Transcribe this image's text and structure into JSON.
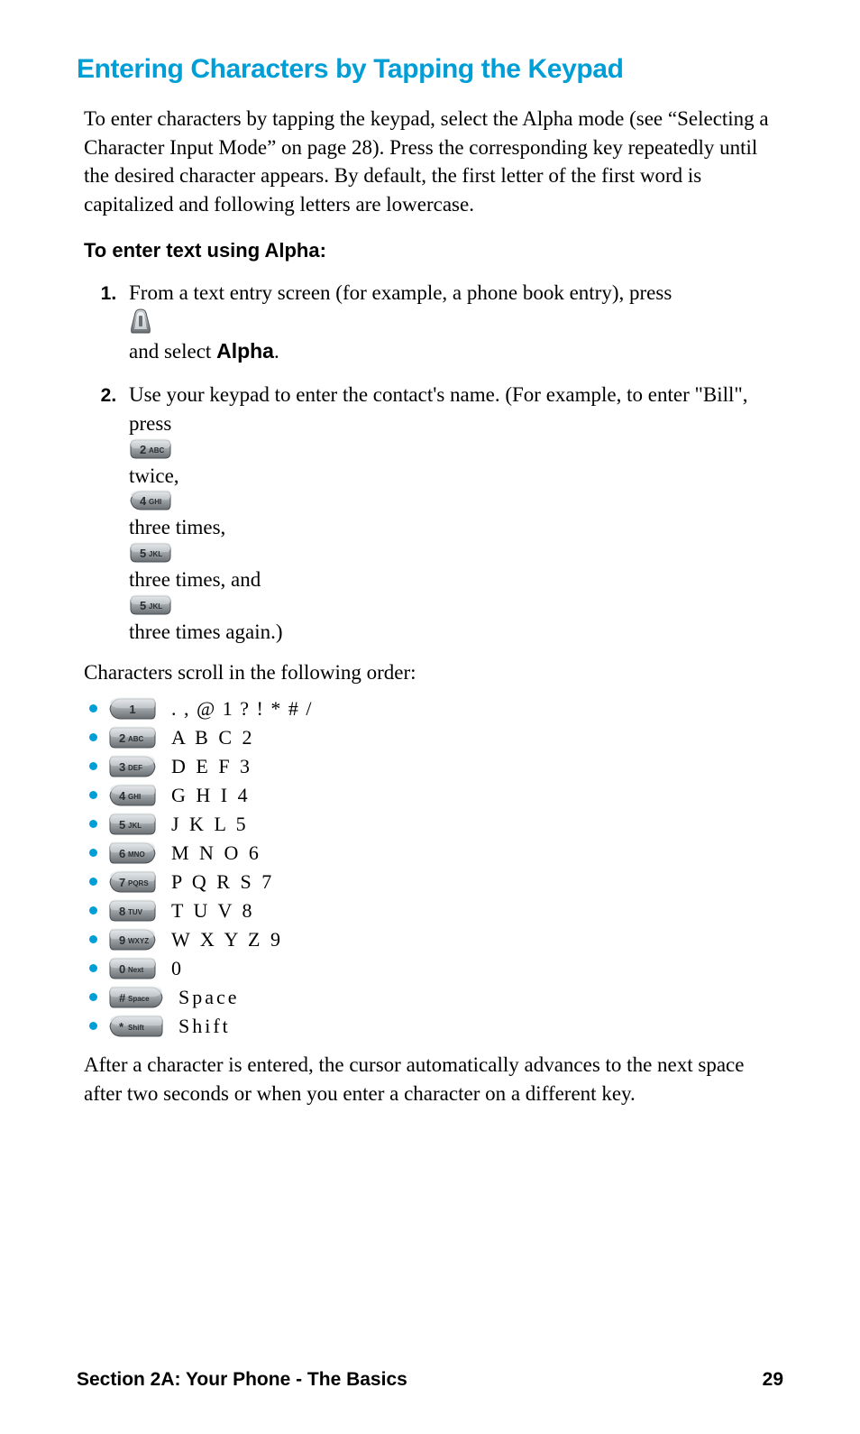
{
  "title": "Entering Characters by Tapping the Keypad",
  "intro": "To enter characters by tapping the keypad, select the Alpha mode (see “Selecting a Character Input Mode” on page 28). Press the corresponding key repeatedly until the desired character appears. By default, the first letter of the first word is capitalized and following letters are lowercase.",
  "subhead": "To enter text using Alpha:",
  "step1_a": "From a text entry screen (for example, a phone book entry), press ",
  "step1_b": " and select ",
  "step1_alpha": "Alpha",
  "step1_c": ".",
  "step2_a": "Use your keypad to enter the contact's name. (For example, to enter \"Bill\", press ",
  "step2_b": " twice, ",
  "step2_c": " three times, ",
  "step2_d": " three times, and ",
  "step2_e": " three times again.)",
  "scroll_intro": "Characters scroll in the following order:",
  "keys": [
    {
      "label": "1",
      "chars": ". , @ 1 ? ! * # /"
    },
    {
      "label": "2 ABC",
      "chars": "A B C 2"
    },
    {
      "label": "3 DEF",
      "chars": "D E F 3"
    },
    {
      "label": "4 GHI",
      "chars": "G H I 4"
    },
    {
      "label": "5 JKL",
      "chars": "J K L 5"
    },
    {
      "label": "6 MNO",
      "chars": "M N O 6"
    },
    {
      "label": "7 PQRS",
      "chars": "P Q R S 7"
    },
    {
      "label": "8 TUV",
      "chars": "T U V 8"
    },
    {
      "label": "9 WXYZ",
      "chars": "W X Y Z 9"
    },
    {
      "label": "0 Next",
      "chars": "0"
    },
    {
      "label": "# Space",
      "chars": "Space"
    },
    {
      "label": "* Shift",
      "chars": "Shift"
    }
  ],
  "after": "After a character is entered, the cursor automatically advances to the next space after two seconds or when you enter a character on a different key.",
  "footer_left": "Section 2A: Your Phone - The Basics",
  "footer_right": "29"
}
